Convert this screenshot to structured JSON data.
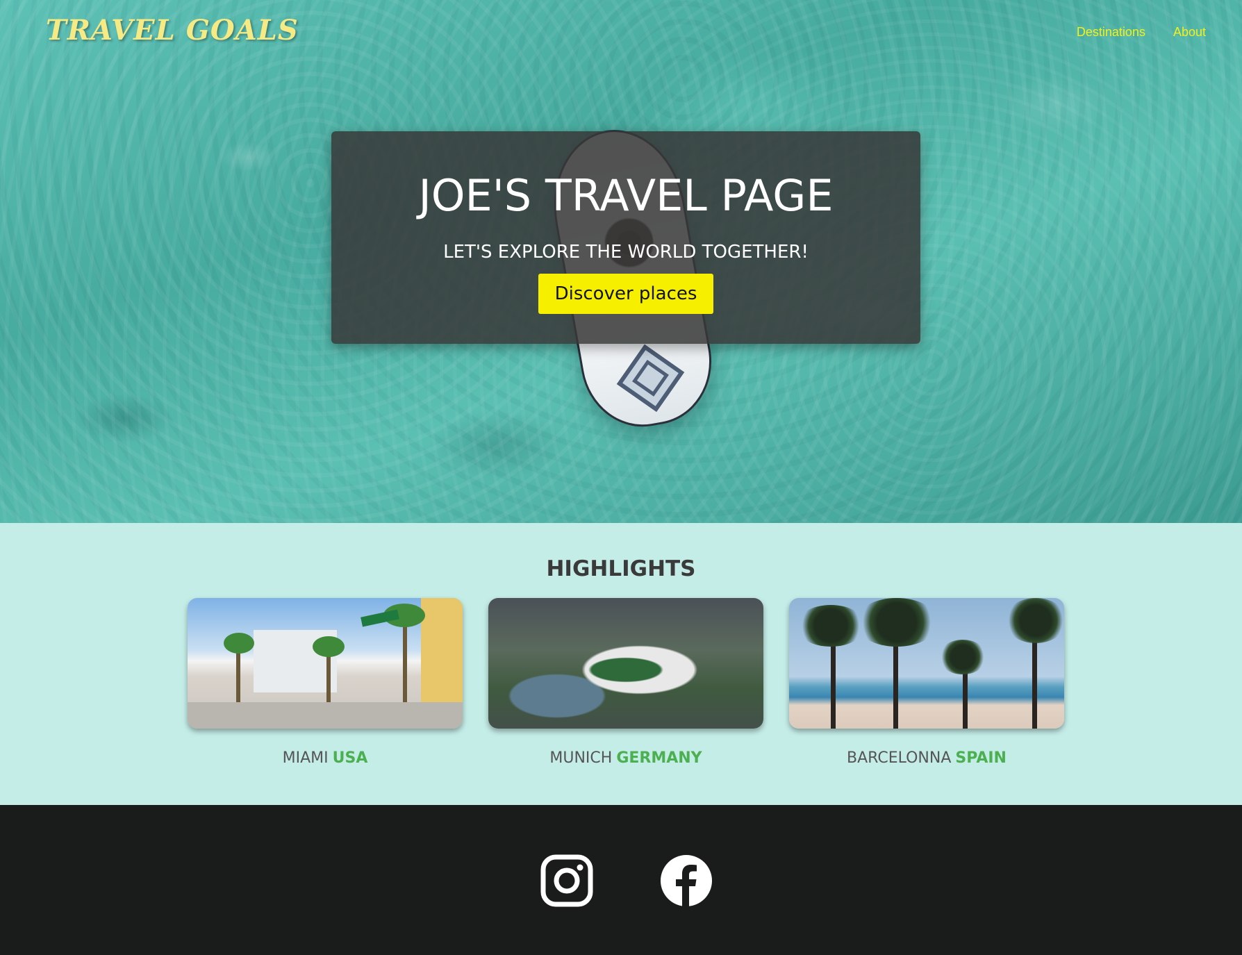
{
  "header": {
    "logo": "TRAVEL GOALS",
    "nav": [
      {
        "label": "Destinations"
      },
      {
        "label": "About"
      }
    ]
  },
  "hero": {
    "title": "JOE'S TRAVEL PAGE",
    "subtitle": "LET'S EXPLORE THE WORLD TOGETHER!",
    "cta_label": "Discover places"
  },
  "highlights": {
    "title": "HIGHLIGHTS",
    "cards": [
      {
        "city": "MIAMI",
        "country": "USA",
        "image": "miami-street-photo"
      },
      {
        "city": "MUNICH",
        "country": "GERMANY",
        "image": "munich-olympic-park-photo"
      },
      {
        "city": "BARCELONNA",
        "country": "SPAIN",
        "image": "barcelona-beach-palms-photo"
      }
    ]
  },
  "footer": {
    "social": [
      {
        "icon": "instagram-icon"
      },
      {
        "icon": "facebook-icon"
      }
    ]
  },
  "colors": {
    "logo": "#f6ea84",
    "nav": "#f4f01a",
    "cta_bg": "#f6f000",
    "highlights_bg": "#c5ede8",
    "country_accent": "#4caf50",
    "footer_bg": "#1a1c1c"
  }
}
